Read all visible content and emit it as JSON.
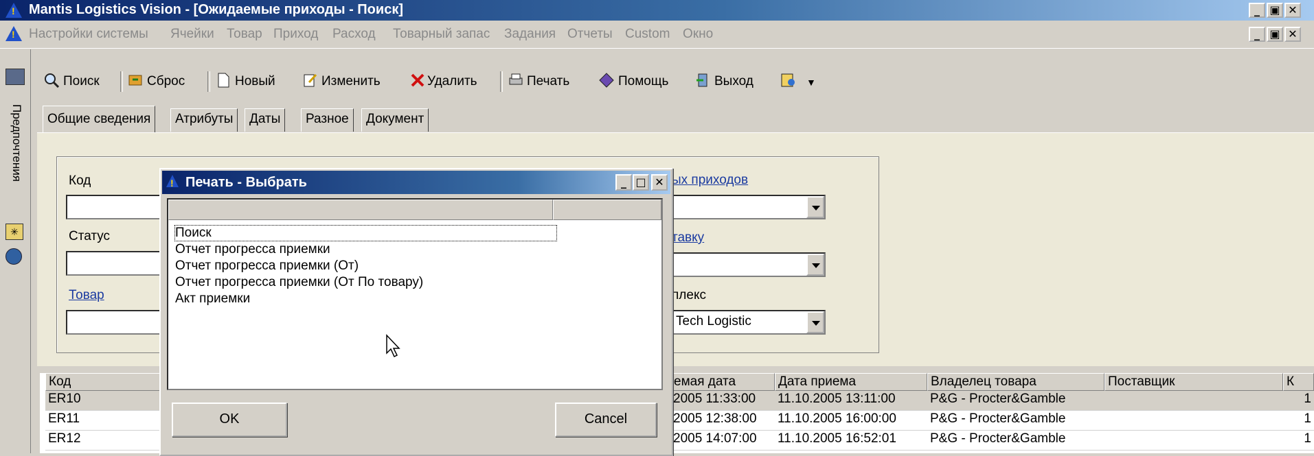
{
  "window": {
    "title": "Mantis Logistics Vision - [Ожидаемые приходы - Поиск]",
    "title_controls": [
      "_",
      "🗗",
      "X"
    ]
  },
  "menu": {
    "items": [
      "Настройки системы",
      "Ячейки",
      "Товар",
      "Приход",
      "Расход",
      "Товарный запас",
      "Задания",
      "Отчеты",
      "Custom",
      "Окно"
    ]
  },
  "sidebar": {
    "label": "Предпочтения"
  },
  "toolbar": {
    "search": "Поиск",
    "reset": "Сброс",
    "new": "Новый",
    "edit": "Изменить",
    "delete": "Удалить",
    "print": "Печать",
    "help": "Помощь",
    "exit": "Выход"
  },
  "tabs": [
    "Общие сведения",
    "Атрибуты",
    "Даты",
    "Разное",
    "Документ"
  ],
  "form": {
    "code_label": "Код",
    "status_label": "Статус",
    "product_label": "Товар",
    "right_link_1": "ых приходов",
    "right_link_2": "тавку",
    "complex_label": "плекс",
    "complex_value": "Tech Logistic"
  },
  "grid": {
    "headers": [
      "Код",
      "емая дата",
      "Дата приема",
      "Владелец товара",
      "Поставщик",
      "К"
    ],
    "rows": [
      {
        "code": "ER10",
        "expected": "2005 11:33:00",
        "received": "11.10.2005 13:11:00",
        "owner": "P&G - Procter&Gamble",
        "supplier": "",
        "k": "1"
      },
      {
        "code": "ER11",
        "expected": "2005 12:38:00",
        "received": "11.10.2005 16:00:00",
        "owner": "P&G - Procter&Gamble",
        "supplier": "",
        "k": "1"
      },
      {
        "code": "ER12",
        "expected": "2005 14:07:00",
        "received": "11.10.2005 16:52:01",
        "owner": "P&G - Procter&Gamble",
        "supplier": "",
        "k": "1"
      }
    ]
  },
  "dialog": {
    "title": "Печать - Выбрать",
    "items": [
      "Поиск",
      "Отчет прогресса приемки",
      "Отчет прогресса приемки (От)",
      "Отчет прогресса приемки (От По товару)",
      "Акт приемки"
    ],
    "ok": "OK",
    "cancel": "Cancel"
  },
  "colors": {
    "title_bar": "#0a246a",
    "link": "#1a3aa0",
    "face": "#d4d0c8"
  }
}
